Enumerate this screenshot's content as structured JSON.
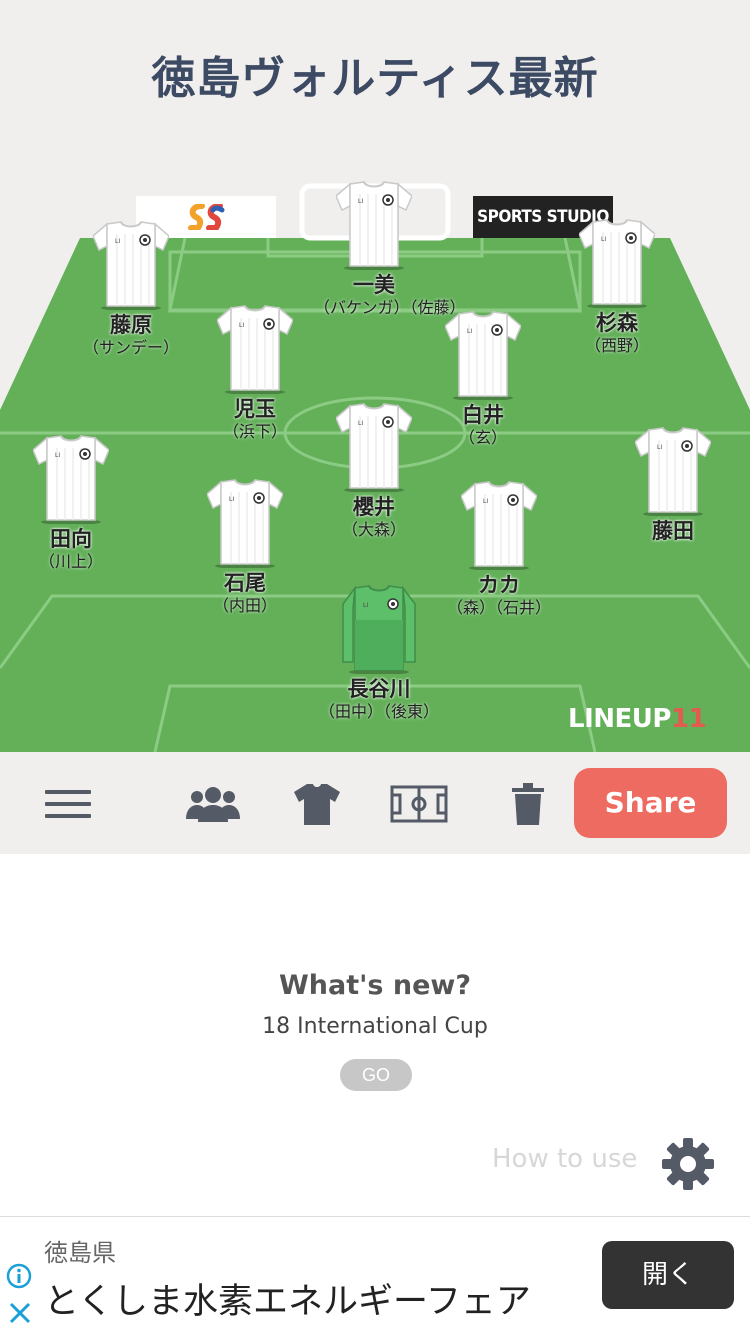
{
  "header": {
    "title": "徳島ヴォルティス最新"
  },
  "sponsors": {
    "left_logo": "ss-logo",
    "right_text": "SPORTS STUDIO"
  },
  "players": [
    {
      "name": "一美",
      "sub": "（バケンガ）（佐藤）",
      "kit": "white"
    },
    {
      "name": "藤原",
      "sub": "（サンデー）",
      "kit": "white"
    },
    {
      "name": "杉森",
      "sub": "（西野）",
      "kit": "white"
    },
    {
      "name": "児玉",
      "sub": "（浜下）",
      "kit": "white"
    },
    {
      "name": "白井",
      "sub": "（玄）",
      "kit": "white"
    },
    {
      "name": "櫻井",
      "sub": "（大森）",
      "kit": "white"
    },
    {
      "name": "田向",
      "sub": "（川上）",
      "kit": "white"
    },
    {
      "name": "藤田",
      "sub": "",
      "kit": "white"
    },
    {
      "name": "石尾",
      "sub": "（内田）",
      "kit": "white"
    },
    {
      "name": "カカ",
      "sub": "（森）（石井）",
      "kit": "white"
    },
    {
      "name": "長谷川",
      "sub": "（田中）（後東）",
      "kit": "goalkeeper-green"
    }
  ],
  "brand": {
    "text": "LINEUP",
    "number": "11"
  },
  "toolbar": {
    "icons": [
      "menu-icon",
      "team-icon",
      "shirt-icon",
      "formation-icon",
      "trash-icon"
    ],
    "share_label": "Share"
  },
  "news": {
    "heading": "What's new?",
    "item": "18 International Cup",
    "go_label": "GO"
  },
  "help": {
    "how_to_use_label": "How to use",
    "icon": "gear-icon"
  },
  "ad": {
    "advertiser": "徳島県",
    "headline": "とくしま水素エネルギーフェア",
    "open_label": "開く"
  },
  "colors": {
    "pitch": "#63b059",
    "pitch_lines": "#8ccb84",
    "title": "#3d4a63",
    "share": "#ee6b61",
    "gk_kit": "#5dbf6a",
    "toolbar_icon": "#555b66"
  }
}
